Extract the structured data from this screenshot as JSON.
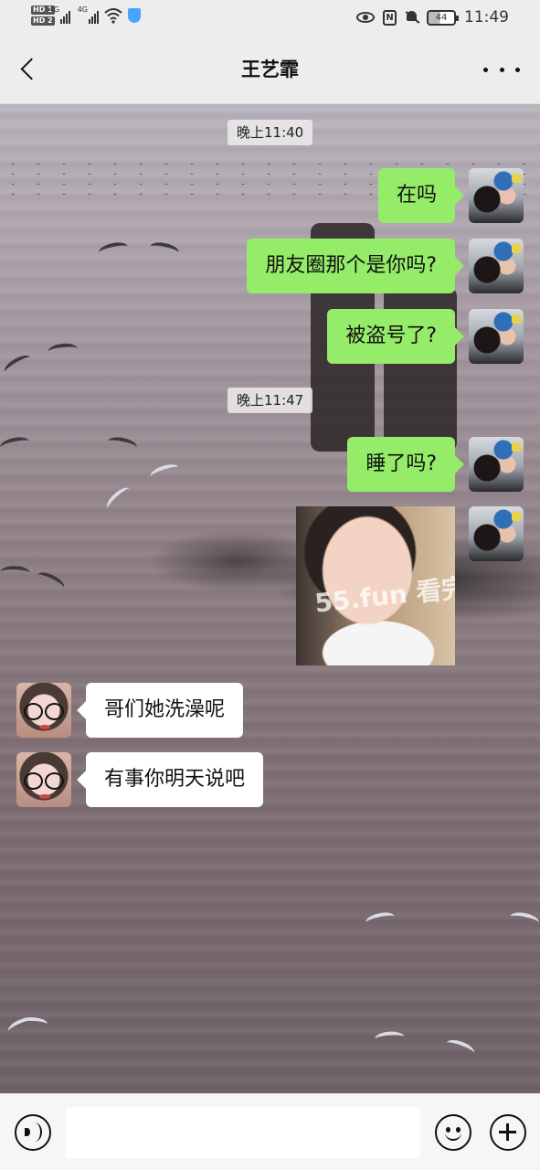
{
  "status_bar": {
    "sim1": "HD 1",
    "sim2": "HD 2",
    "network1": "4G",
    "network2": "4G",
    "nfc": "N",
    "battery": "44",
    "time": "11:49"
  },
  "header": {
    "title": "王艺霏",
    "back_icon": "chevron-left-icon",
    "more_icon": "more-dots-icon"
  },
  "messages": {
    "timestamp1": "晚上11:40",
    "m1": "在吗",
    "m2": "朋友圈那个是你吗?",
    "m3": "被盗号了?",
    "timestamp2": "晚上11:47",
    "m4": "睡了吗?",
    "image_watermark": "55.fun 看完",
    "r1": "哥们她洗澡呢",
    "r2": "有事你明天说吧"
  },
  "input_bar": {
    "voice_icon": "voice-icon",
    "text_value": "",
    "emoji_icon": "emoji-icon",
    "plus_icon": "plus-icon"
  },
  "colors": {
    "outgoing_bubble": "#95ec69",
    "incoming_bubble": "#ffffff",
    "bar_background": "#ededed"
  }
}
